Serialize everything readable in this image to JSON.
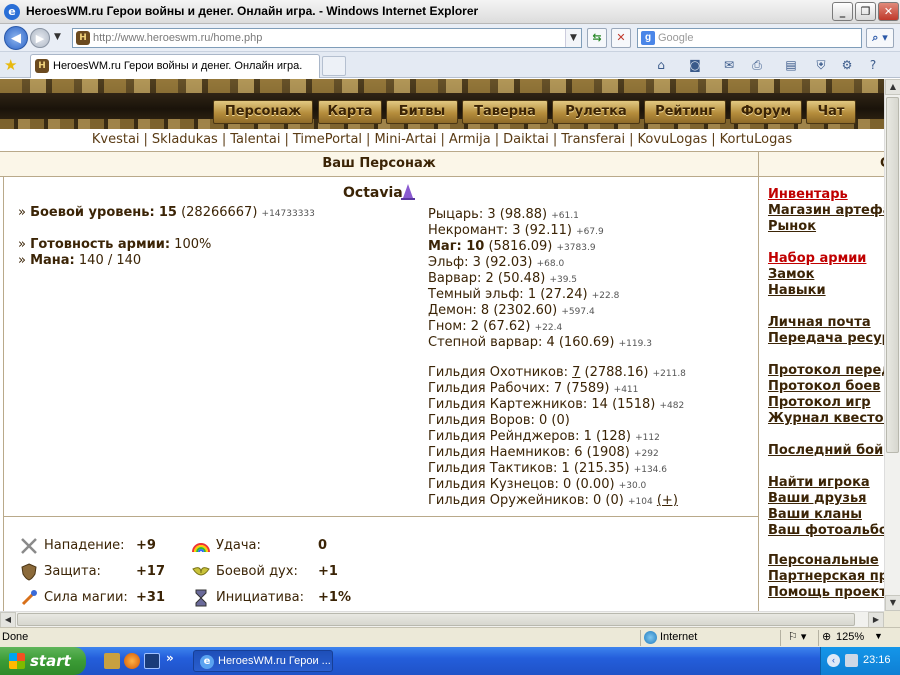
{
  "window": {
    "title": "HeroesWM.ru Герои войны и денег. Онлайн игра. - Windows Internet Explorer"
  },
  "addressbar": {
    "url": "http://www.heroeswm.ru/home.php",
    "search_placeholder": "Google"
  },
  "tab": {
    "label": "HeroesWM.ru Герои войны и денег. Онлайн игра."
  },
  "menu": [
    "Персонаж",
    "Карта",
    "Битвы",
    "Таверна",
    "Рулетка",
    "Рейтинг",
    "Форум",
    "Чат"
  ],
  "sublinks": [
    "Kvestai",
    "Skladukas",
    "Talentai",
    "TimePortal",
    "Mini-Artai",
    "Armija",
    "Daiktai",
    "Transferai",
    "KovuLogas",
    "KortuLogas"
  ],
  "panel": {
    "title": "Ваш Персонаж",
    "right_title": "С"
  },
  "character": {
    "name": "Octavia",
    "level_label": "Боевой уровень:",
    "level": "15",
    "exp": "(28266667)",
    "exp_delta": "+14733333",
    "army_label": "Готовность армии:",
    "army": "100%",
    "mana_label": "Мана:",
    "mana": "140 / 140"
  },
  "factions": [
    {
      "text": "Рыцарь: 3 (98.88)",
      "delta": "+61.1",
      "bold": false
    },
    {
      "text": "Некромант: 3 (92.11)",
      "delta": "+67.9",
      "bold": false
    },
    {
      "name": "Маг: 10",
      "text": " (5816.09)",
      "delta": "+3783.9",
      "bold": true
    },
    {
      "text": "Эльф: 3 (92.03)",
      "delta": "+68.0",
      "bold": false
    },
    {
      "text": "Варвар: 2 (50.48)",
      "delta": "+39.5",
      "bold": false
    },
    {
      "text": "Темный эльф: 1 (27.24)",
      "delta": "+22.8",
      "bold": false
    },
    {
      "text": "Демон: 8 (2302.60)",
      "delta": "+597.4",
      "bold": false
    },
    {
      "text": "Гном: 2 (67.62)",
      "delta": "+22.4",
      "bold": false
    },
    {
      "text": "Степной варвар: 4 (160.69)",
      "delta": "+119.3",
      "bold": false
    }
  ],
  "guilds": [
    {
      "prefix": "Гильдия Охотников: ",
      "level": "7",
      "text": " (2788.16)",
      "delta": "+211.8"
    },
    {
      "prefix": "Гильдия Рабочих: ",
      "level": "7",
      "text": " (7589)",
      "delta": "+411"
    },
    {
      "prefix": "Гильдия Картежников: ",
      "level": "14",
      "text": " (1518)",
      "delta": "+482"
    },
    {
      "prefix": "Гильдия Воров: ",
      "level": "0",
      "text": " (0)",
      "delta": ""
    },
    {
      "prefix": "Гильдия Рейнджеров: ",
      "level": "1",
      "text": " (128)",
      "delta": "+112"
    },
    {
      "prefix": "Гильдия Наемников: ",
      "level": "6",
      "text": " (1908)",
      "delta": "+292"
    },
    {
      "prefix": "Гильдия Тактиков: ",
      "level": "1",
      "text": " (215.35)",
      "delta": "+134.6"
    },
    {
      "prefix": "Гильдия Кузнецов: ",
      "level": "0",
      "text": " (0.00)",
      "delta": "+30.0"
    },
    {
      "prefix": "Гильдия Оружейников: ",
      "level": "0",
      "text": " (0)",
      "delta": "+104",
      "extra": "(+)"
    }
  ],
  "attributes": [
    {
      "label": "Нападение:",
      "value": "+9",
      "icon": "swords-icon"
    },
    {
      "label": "Защита:",
      "value": "+17",
      "icon": "shield-icon"
    },
    {
      "label": "Сила магии:",
      "value": "+31",
      "icon": "wand-icon"
    },
    {
      "label": "Удача:",
      "value": "0",
      "icon": "rainbow-icon"
    },
    {
      "label": "Боевой дух:",
      "value": "+1",
      "icon": "wings-icon"
    },
    {
      "label": "Инициатива:",
      "value": "+1%",
      "icon": "hourglass-icon"
    }
  ],
  "right_links": [
    {
      "label": "Инвентарь",
      "red": true
    },
    {
      "label": "Магазин артефактов",
      "red": false
    },
    {
      "label": "Рынок",
      "red": false
    },
    {
      "label": "Набор армии",
      "red": true
    },
    {
      "label": "Замок",
      "red": false
    },
    {
      "label": "Навыки",
      "red": false
    },
    {
      "label": "Личная почта",
      "red": false
    },
    {
      "label": "Передача ресурсов",
      "red": false
    },
    {
      "label": "Протокол передач",
      "red": false
    },
    {
      "label": "Протокол боев",
      "red": false
    },
    {
      "label": "Протокол игр",
      "red": false
    },
    {
      "label": "Журнал квестов",
      "red": false
    },
    {
      "label": "Последний бой",
      "red": false
    },
    {
      "label": "Найти игрока",
      "red": false
    },
    {
      "label": "Ваши друзья",
      "red": false
    },
    {
      "label": "Ваши кланы",
      "red": false
    },
    {
      "label": "Ваш фотоальбом",
      "red": false
    },
    {
      "label": "Персональные",
      "red": false
    },
    {
      "label": "Партнерская программа",
      "red": false
    },
    {
      "label": "Помощь проекту",
      "red": false
    }
  ],
  "statusbar": {
    "status": "Done",
    "zone": "Internet",
    "zoom": "125%"
  },
  "taskbar": {
    "start": "start",
    "item": "HeroesWM.ru Герои ...",
    "clock": "23:16"
  }
}
